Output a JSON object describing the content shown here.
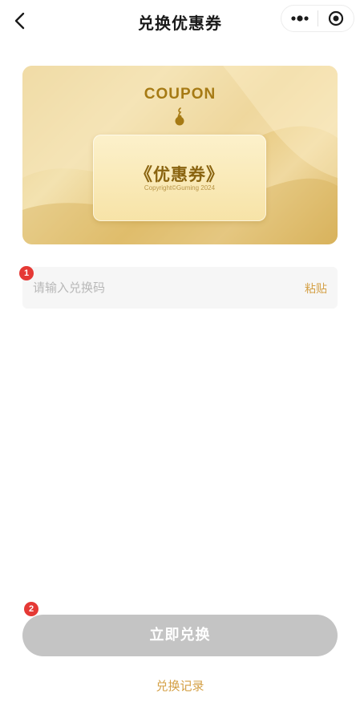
{
  "nav": {
    "title": "兑换优惠券",
    "back_icon": "chevron-left-icon",
    "more_icon": "more-dots-icon",
    "close_icon": "target-circle-icon"
  },
  "card": {
    "heading": "COUPON",
    "inner_title_left": "《",
    "inner_title": "优惠券",
    "inner_title_right": "》",
    "copyright": "Copyright©Guming 2024",
    "accent_color": "#a67a14"
  },
  "redeem": {
    "placeholder": "请输入兑换码",
    "value": "",
    "paste_label": "粘贴"
  },
  "markers": [
    "1",
    "2"
  ],
  "actions": {
    "redeem_label": "立即兑换",
    "history_label": "兑换记录",
    "disabled_color": "#c4c4c4",
    "link_color": "#d4a046"
  }
}
